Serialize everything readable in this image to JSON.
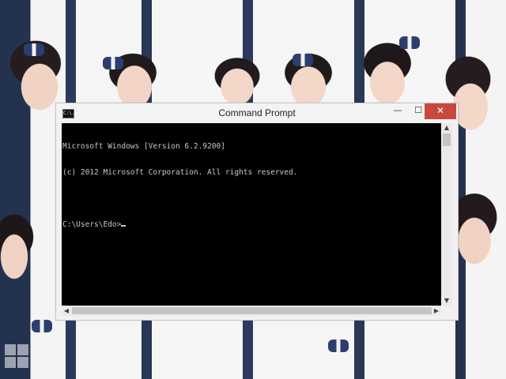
{
  "window": {
    "title": "Command Prompt",
    "icon": "cmd-icon",
    "icon_text": "C:\\.",
    "controls": {
      "minimize": "—",
      "maximize": "☐",
      "close": "✕"
    }
  },
  "console": {
    "lines": [
      "Microsoft Windows [Version 6.2.9200]",
      "(c) 2012 Microsoft Corporation. All rights reserved.",
      "",
      "C:\\Users\\Edo>"
    ]
  },
  "scrollbars": {
    "up": "▲",
    "down": "▼",
    "left": "◀",
    "right": "▶"
  },
  "desktop": {
    "logo_icon": "windows-logo-icon"
  }
}
